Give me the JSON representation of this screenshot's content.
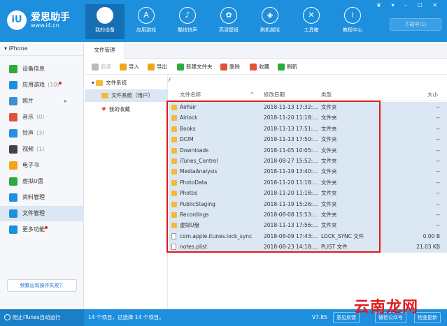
{
  "app": {
    "brand_badge": "iU",
    "name": "爱思助手",
    "url": "www.i4.cn",
    "window_controls": "❦ ▾ – ☐ ✕",
    "download_button": "下载中(1)"
  },
  "nav": [
    {
      "label": "我的设备",
      "icon": "apple-icon",
      "glyph": "",
      "active": true
    },
    {
      "label": "应用游戏",
      "icon": "appstore-icon",
      "glyph": "A",
      "active": false
    },
    {
      "label": "酷炫铃声",
      "icon": "bell-icon",
      "glyph": "♪",
      "active": false
    },
    {
      "label": "高清壁纸",
      "icon": "flower-icon",
      "glyph": "✿",
      "active": false
    },
    {
      "label": "刷机越狱",
      "icon": "box-icon",
      "glyph": "◈",
      "active": false
    },
    {
      "label": "工具箱",
      "icon": "tools-icon",
      "glyph": "✕",
      "active": false
    },
    {
      "label": "教程中心",
      "icon": "info-icon",
      "glyph": "i",
      "active": false
    }
  ],
  "sidebar": {
    "device": "iPhone",
    "items": [
      {
        "label": "设备信息",
        "count": "",
        "color": "#2eaa3a",
        "dot": false
      },
      {
        "label": "应用游戏",
        "count": "(10)",
        "color": "#1e8fdd",
        "dot": true
      },
      {
        "label": "照片",
        "count": "",
        "color": "#3b8fd6",
        "dot": false,
        "arrow": "▸"
      },
      {
        "label": "音乐",
        "count": "(0)",
        "color": "#e2533a",
        "dot": false
      },
      {
        "label": "铃声",
        "count": "(3)",
        "color": "#2d8de0",
        "dot": false
      },
      {
        "label": "视频",
        "count": "(1)",
        "color": "#444444",
        "dot": false
      },
      {
        "label": "电子书",
        "count": "",
        "color": "#f2a516",
        "dot": false
      },
      {
        "label": "虚拟U盘",
        "count": "",
        "color": "#2eaa3a",
        "dot": false
      },
      {
        "label": "资料管理",
        "count": "",
        "color": "#1e8fdd",
        "dot": false
      },
      {
        "label": "文件管理",
        "count": "",
        "color": "#1e8fdd",
        "dot": false,
        "active": true
      },
      {
        "label": "更多功能",
        "count": "",
        "color": "#1e8fdd",
        "dot": true
      }
    ],
    "repair_button": "频繁出现操作失败？"
  },
  "tab": "文件管理",
  "toolbar": [
    {
      "label": "后退",
      "icon": "back-icon",
      "color": "#bbbbbb",
      "disabled": true
    },
    {
      "label": "导入",
      "icon": "import-icon",
      "color": "#f2a516"
    },
    {
      "label": "导出",
      "icon": "export-icon",
      "color": "#f2a516"
    },
    {
      "label": "新建文件夹",
      "icon": "new-folder-icon",
      "color": "#2eaa3a"
    },
    {
      "label": "删除",
      "icon": "delete-icon",
      "color": "#e2533a"
    },
    {
      "label": "收藏",
      "icon": "heart-icon",
      "color": "#e2533a"
    },
    {
      "label": "刷新",
      "icon": "refresh-icon",
      "color": "#2eaa3a"
    }
  ],
  "tree": {
    "root": "文件系统",
    "child": "文件系统（用户）",
    "favorites": "我的收藏"
  },
  "path": "/",
  "columns": {
    "name": "文件名称",
    "date": "修改日期",
    "type": "类型",
    "size": "大小",
    "sort": "^"
  },
  "files": [
    {
      "name": "AirFair",
      "date": "2018-11-13 17:32:...",
      "type": "文件夹",
      "size": "--",
      "kind": "folder"
    },
    {
      "name": "Airlock",
      "date": "2018-11-20 11:18:...",
      "type": "文件夹",
      "size": "--",
      "kind": "folder"
    },
    {
      "name": "Books",
      "date": "2018-11-13 17:51:...",
      "type": "文件夹",
      "size": "--",
      "kind": "folder"
    },
    {
      "name": "DCIM",
      "date": "2018-11-13 17:50:...",
      "type": "文件夹",
      "size": "--",
      "kind": "folder"
    },
    {
      "name": "Downloads",
      "date": "2018-11-05 10:05:...",
      "type": "文件夹",
      "size": "--",
      "kind": "folder"
    },
    {
      "name": "iTunes_Control",
      "date": "2018-08-27 15:52:...",
      "type": "文件夹",
      "size": "--",
      "kind": "folder"
    },
    {
      "name": "MediaAnalysis",
      "date": "2018-11-19 13:40:...",
      "type": "文件夹",
      "size": "--",
      "kind": "folder"
    },
    {
      "name": "PhotoData",
      "date": "2018-11-20 11:18:...",
      "type": "文件夹",
      "size": "--",
      "kind": "folder"
    },
    {
      "name": "Photos",
      "date": "2018-11-20 11:18:...",
      "type": "文件夹",
      "size": "--",
      "kind": "folder"
    },
    {
      "name": "PublicStaging",
      "date": "2018-11-19 15:26:...",
      "type": "文件夹",
      "size": "--",
      "kind": "folder"
    },
    {
      "name": "Recordings",
      "date": "2018-08-08 15:53:...",
      "type": "文件夹",
      "size": "--",
      "kind": "folder"
    },
    {
      "name": "虚拟U盘",
      "date": "2018-11-13 17:56:...",
      "type": "文件夹",
      "size": "--",
      "kind": "folder"
    },
    {
      "name": "com.apple.itunes.lock_sync",
      "date": "2018-08-09 17:43:...",
      "type": "LOCK_SYNC 文件",
      "size": "0.00 B",
      "kind": "file"
    },
    {
      "name": "notes.plist",
      "date": "2018-08-23 14:18:...",
      "type": "PLIST 文件",
      "size": "21.03 KB",
      "kind": "file"
    }
  ],
  "status": {
    "itunes": "阻止iTunes自动运行",
    "count": "14 个项目，已选择 14 个项目。",
    "version": "V7.85",
    "feedback": "意见反馈",
    "wechat": "微信公众号",
    "update": "检查更新"
  },
  "watermark": "云南龙网"
}
